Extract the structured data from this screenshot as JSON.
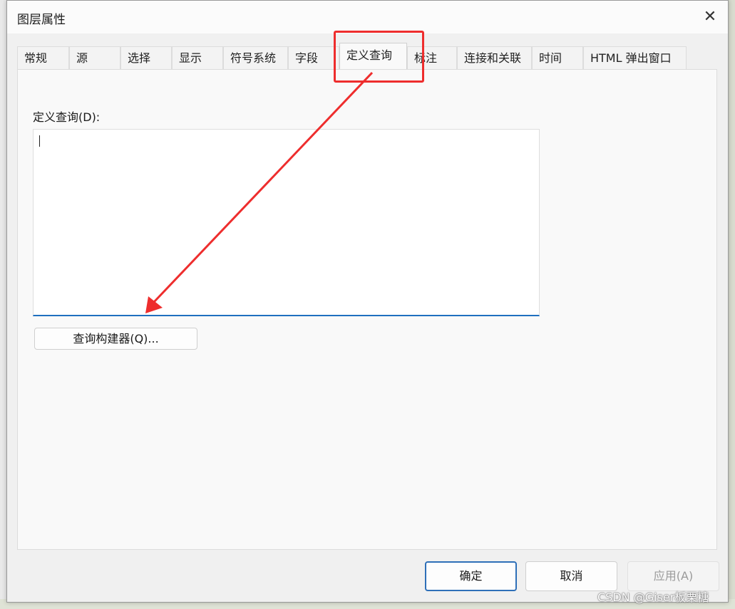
{
  "dialog": {
    "title": "图层属性",
    "close_glyph": "✕"
  },
  "tabs": [
    {
      "label": "常规"
    },
    {
      "label": "源"
    },
    {
      "label": "选择"
    },
    {
      "label": "显示"
    },
    {
      "label": "符号系统"
    },
    {
      "label": "字段"
    },
    {
      "label": "定义查询",
      "active": true
    },
    {
      "label": "标注"
    },
    {
      "label": "连接和关联"
    },
    {
      "label": "时间"
    },
    {
      "label": "HTML 弹出窗口"
    }
  ],
  "panel": {
    "query_label": "定义查询(D):",
    "query_value": "",
    "builder_button": "查询构建器(Q)..."
  },
  "footer": {
    "ok": "确定",
    "cancel": "取消",
    "apply": "应用(A)"
  },
  "annotation": {
    "color": "#ee2d2d"
  },
  "watermark": "CSDN @Giser板栗糖"
}
